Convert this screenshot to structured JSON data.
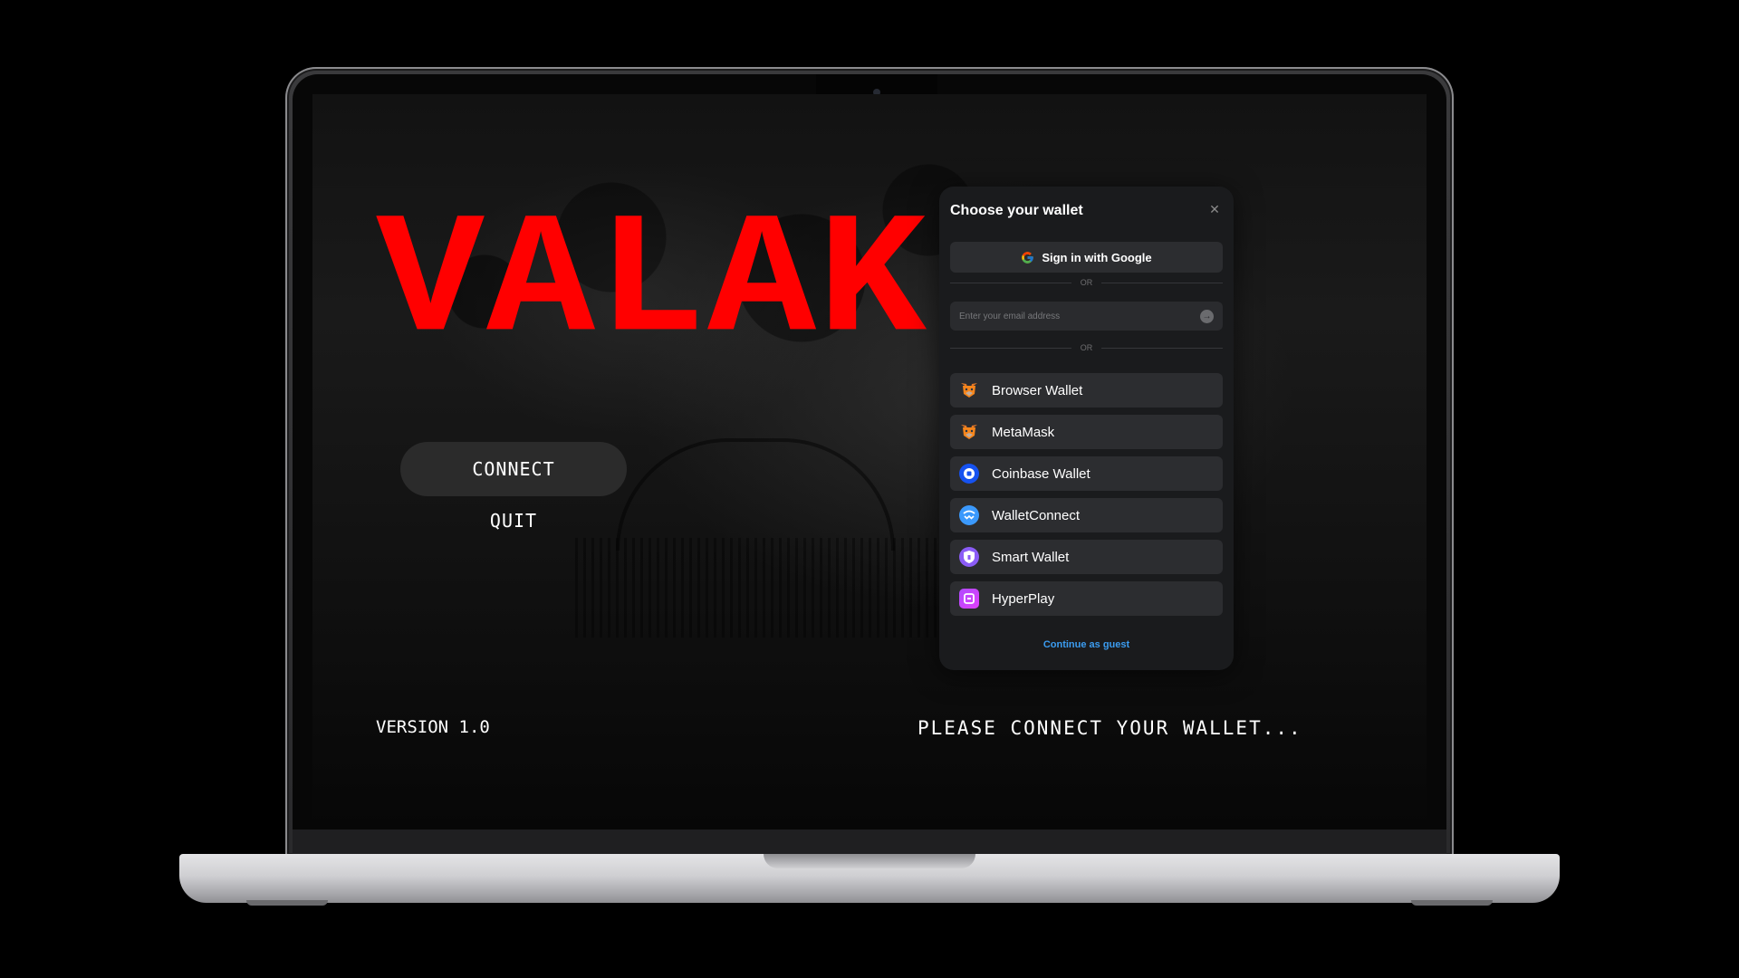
{
  "game": {
    "title": "VALAK",
    "menu": {
      "connect_label": "CONNECT",
      "quit_label": "QUIT"
    },
    "version": "VERSION 1.0",
    "status": "PLEASE CONNECT YOUR WALLET...",
    "title_color": "#ff0000"
  },
  "wallet_modal": {
    "title": "Choose your wallet",
    "close_icon": "close-icon",
    "google_button": "Sign in with Google",
    "divider_text": "OR",
    "email_placeholder": "Enter your email address",
    "wallets": [
      {
        "label": "Browser Wallet",
        "icon": "metamask-fox-icon"
      },
      {
        "label": "MetaMask",
        "icon": "metamask-fox-icon"
      },
      {
        "label": "Coinbase Wallet",
        "icon": "coinbase-icon"
      },
      {
        "label": "WalletConnect",
        "icon": "walletconnect-icon"
      },
      {
        "label": "Smart Wallet",
        "icon": "smart-wallet-shield-icon"
      },
      {
        "label": "HyperPlay",
        "icon": "hyperplay-icon"
      }
    ],
    "guest_link": "Continue as guest",
    "link_color": "#3b9cf0"
  }
}
